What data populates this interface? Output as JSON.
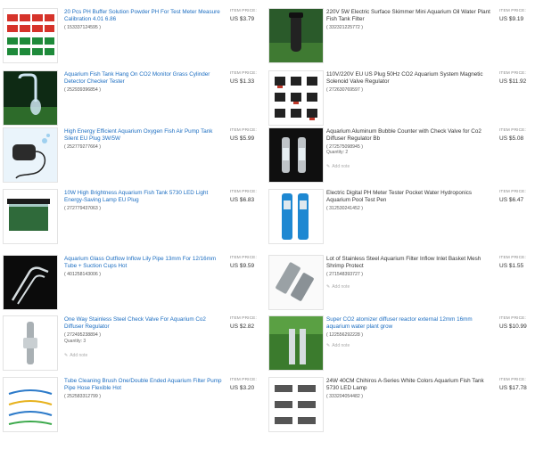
{
  "price_label": "ITEM PRICE:",
  "add_note_label": "Add note",
  "quantity_prefix": "Quantity:",
  "items": [
    {
      "title": "20 Pcs PH Buffer Solution Powder PH For Test Meter Measure Calibration 4.01 6.86",
      "sku": "( 153337124595 )",
      "price": "US $3.79",
      "icon": "ph-buffer-packets-icon"
    },
    {
      "title": "220V 5W Electric Surface Skimmer Mini Aquarium Oil Water Plant Fish Tank Filter",
      "sku": "( 332321225772 )",
      "price": "US $9.19",
      "icon": "skimmer-filter-icon"
    },
    {
      "title": "Aquarium Fish Tank Hang On CO2 Monitor Grass Cylinder Detector Checker Tester",
      "sku": "( 252939396854 )",
      "price": "US $1.33",
      "icon": "co2-glass-monitor-icon"
    },
    {
      "title": "110V/220V EU US Plug 50Hz CO2 Aquarium System Magnetic Solenoid Valve Regulator",
      "sku": "( 272630769597 )",
      "price": "US $11.92",
      "icon": "solenoid-valves-icon"
    },
    {
      "title": "High Energy Efficient Aquarium Oxygen Fish Air Pump Tank Silent EU Plug 3W/5W",
      "sku": "( 252779277664 )",
      "price": "US $5.99",
      "icon": "air-pump-icon"
    },
    {
      "title": "Aquarium Aluminum Bubble Counter with Check Valve for Co2 Diffuser Regulator Bb",
      "sku": "( 272575098945 )",
      "price": "US $5.08",
      "quantity": "2",
      "add_note": true,
      "icon": "bubble-counter-icon"
    },
    {
      "title": "10W High Brightness Aquarium Fish Tank 5730 LED Light Energy-Saving Lamp EU Plug",
      "sku": "( 272779437063 )",
      "price": "US $6.83",
      "icon": "led-lamp-icon"
    },
    {
      "title": "Electric Digital PH Meter Tester Pocket Water Hydroponics Aquarium Pool Test Pen",
      "sku": "( 312530241452 )",
      "price": "US $6.47",
      "icon": "ph-meter-pen-icon"
    },
    {
      "title": "Aquarium Glass Outflow Inflow Lily Pipe 13mm For 12/16mm Tube + Suction Cups Hot",
      "sku": "( 401258143006 )",
      "price": "US $9.59",
      "icon": "lily-pipe-icon"
    },
    {
      "title": "Lot of Stainless Steel Aquarium Filter Inflow Inlet Basket Mesh Shrimp Protect",
      "sku": "( 271548393727 )",
      "price": "US $1.55",
      "add_note": true,
      "icon": "filter-basket-icon"
    },
    {
      "title": "One Way Stainless Steel Check Valve For Aquarium Co2 Diffuser Regulator",
      "sku": "( 272495238894 )",
      "price": "US $2.82",
      "quantity": "3",
      "add_note": true,
      "icon": "check-valve-icon"
    },
    {
      "title": "Super CO2 atomizer diffuser reactor external 12mm 16mm aquarium water plant grow",
      "sku": "( 122556292228 )",
      "price": "US $10.99",
      "add_note": true,
      "icon": "co2-atomizer-icon"
    },
    {
      "title": "Tube Cleaning Brush One/Double Ended Aquarium Filter Pump Pipe Hose Flexible Hot",
      "sku": "( 252583312799 )",
      "price": "US $3.20",
      "icon": "cleaning-brush-icon"
    },
    {
      "title": "24W 40CM Chihiros A-Series White Colors Aquarium Fish Tank 5730 LED Lamp",
      "sku": "( 333204054482 )",
      "price": "US $17.78",
      "icon": "chihiros-lamp-icon"
    }
  ]
}
